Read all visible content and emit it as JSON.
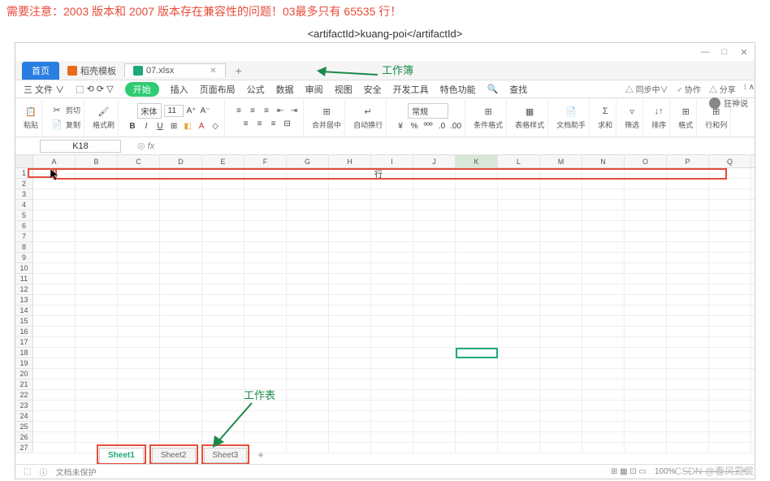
{
  "warning_text": "需要注意：2003 版本和 2007 版本存在兼容性的问题！03最多只有 65535 行！",
  "code_line": "<artifactId>kuang-poi</artifactId>",
  "window": {
    "min": "—",
    "max": "□",
    "close": "✕",
    "user": "狂神说"
  },
  "tabs": {
    "home": "首页",
    "doc1": "稻壳模板",
    "doc2": "07.xlsx"
  },
  "menu": {
    "file": "三 文件 ∨",
    "items": [
      "开始",
      "插入",
      "页面布局",
      "公式",
      "数据",
      "审阅",
      "视图",
      "安全",
      "开发工具",
      "特色功能"
    ],
    "search": "查找",
    "sync": "△ 同步中∨",
    "coop": "♂ 协作",
    "share": "△ 分享"
  },
  "ribbon": {
    "paste": "粘贴",
    "cut": "剪切",
    "copy": "复制",
    "brush": "格式刷",
    "font_name": "宋体",
    "font_size": "11",
    "merge": "合并居中",
    "wrap": "自动换行",
    "numfmt": "常规",
    "condfmt": "条件格式",
    "tablestyle": "表格样式",
    "assist": "文档助手",
    "sum": "求和",
    "filter": "筛选",
    "sort": "排序",
    "format": "格式",
    "rowcol": "行和列"
  },
  "namebox": "K18",
  "fx_label": "fx",
  "columns": [
    "A",
    "B",
    "C",
    "D",
    "E",
    "F",
    "G",
    "H",
    "I",
    "J",
    "K",
    "L",
    "M",
    "N",
    "O",
    "P",
    "Q"
  ],
  "row_count": 27,
  "row_annotation": "行",
  "annot_workbook": "工作簿",
  "annot_worksheet": "工作表",
  "sheets": [
    "Sheet1",
    "Sheet2",
    "Sheet3"
  ],
  "status": {
    "protect": "文档未保护",
    "zoom": "100%"
  },
  "watermark": "CSDN @春风霓裳",
  "active_cell": {
    "col_index": 10,
    "row_index": 17
  }
}
